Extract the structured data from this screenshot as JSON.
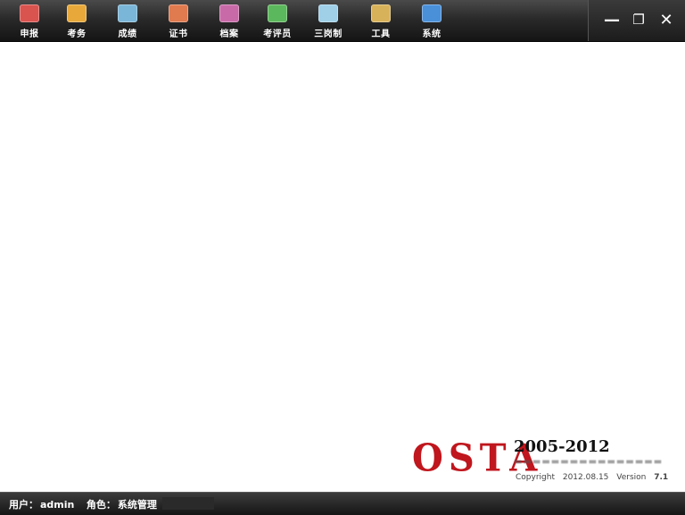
{
  "toolbar": {
    "items": [
      {
        "label": "申报",
        "icon": "report-icon",
        "color": "#d9534f"
      },
      {
        "label": "考务",
        "icon": "exam-affairs-icon",
        "color": "#e8a93a"
      },
      {
        "label": "成绩",
        "icon": "scores-icon",
        "color": "#7ab6d8"
      },
      {
        "label": "证书",
        "icon": "certificate-icon",
        "color": "#e07a4f"
      },
      {
        "label": "档案",
        "icon": "archive-icon",
        "color": "#c86aa8"
      },
      {
        "label": "考评员",
        "icon": "examiner-icon",
        "color": "#5cb85c"
      },
      {
        "label": "三岗制",
        "icon": "three-post-icon",
        "color": "#9fd0e8"
      },
      {
        "label": "工具",
        "icon": "tools-icon",
        "color": "#d8b25a"
      },
      {
        "label": "系统",
        "icon": "system-icon",
        "color": "#4a90d9"
      }
    ]
  },
  "window_controls": {
    "minimize": "—",
    "restore": "❐",
    "close": "✕"
  },
  "logo": {
    "brand": "OSTA",
    "years": "2005-2012",
    "copyright_label": "Copyright",
    "date": "2012.08.15",
    "version_label": "Version",
    "version": "7.1"
  },
  "status": {
    "user_label": "用户：",
    "user": "admin",
    "role_label": "角色：",
    "role": "系统管理"
  }
}
